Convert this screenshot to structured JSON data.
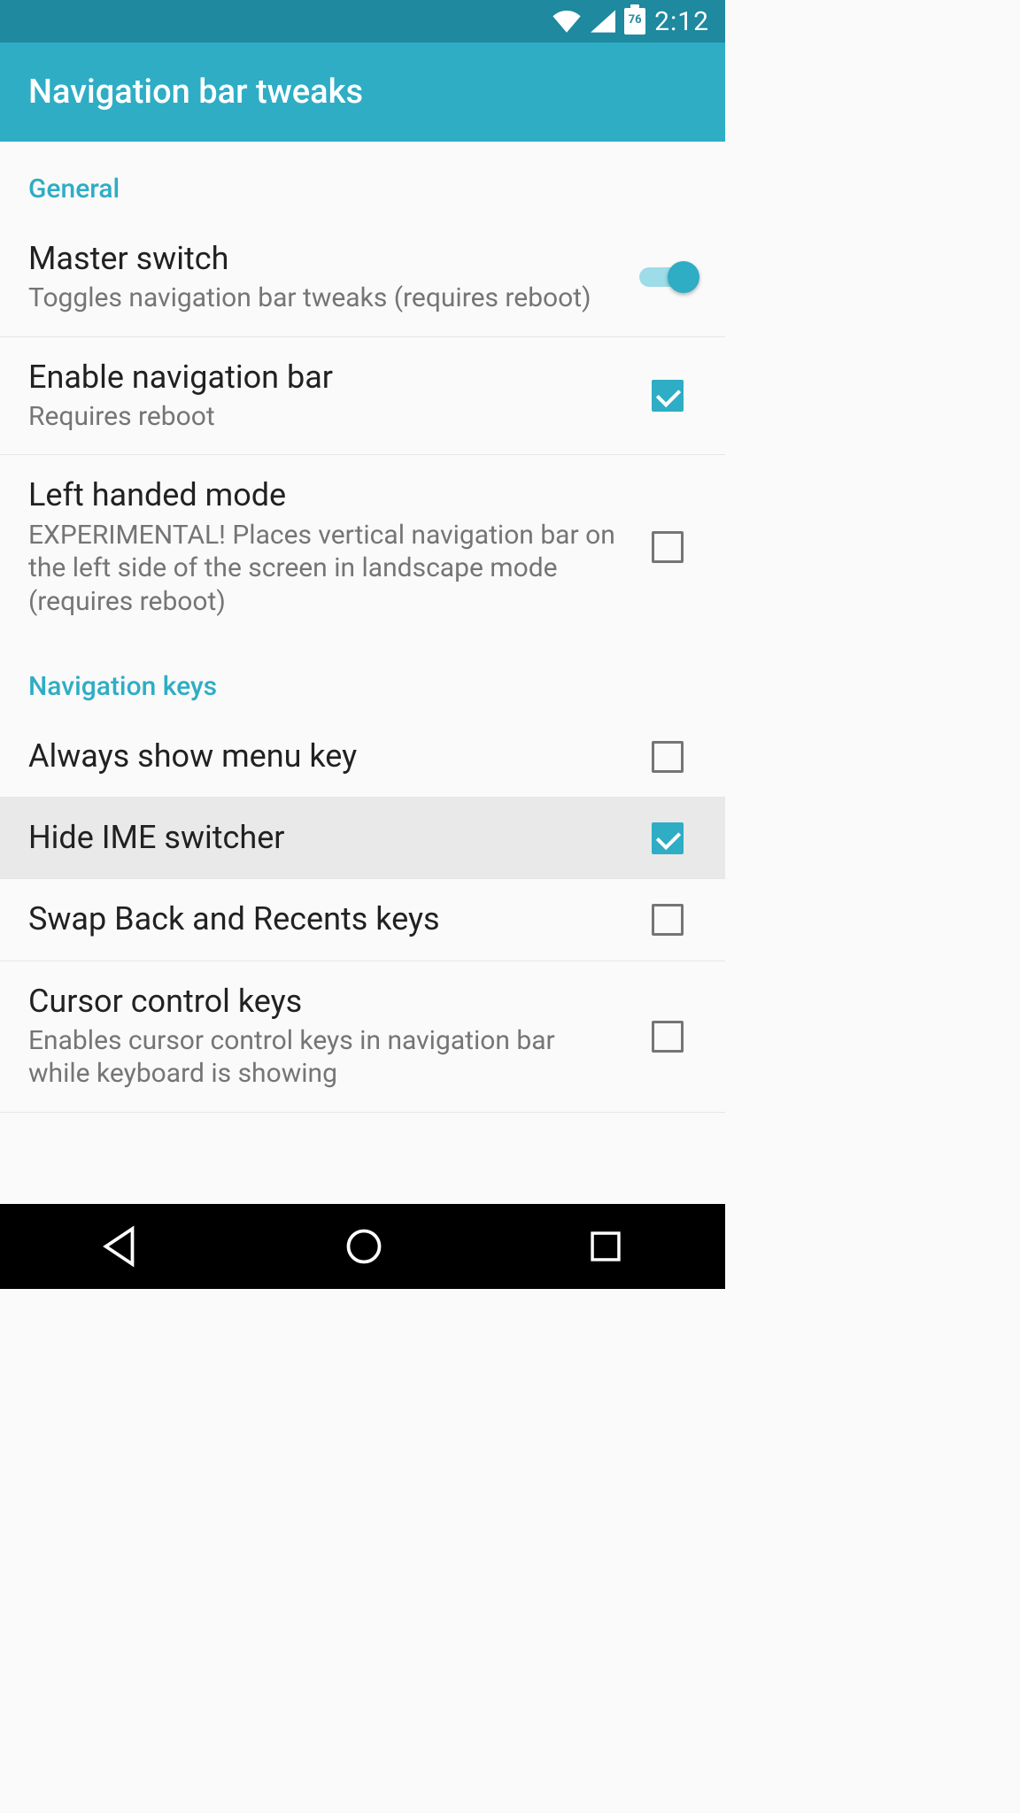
{
  "status": {
    "battery": "76",
    "time": "2:12"
  },
  "app_bar": {
    "title": "Navigation bar tweaks"
  },
  "sections": {
    "general": {
      "header": "General",
      "master_switch": {
        "title": "Master switch",
        "sub": "Toggles navigation bar tweaks (requires reboot)",
        "on": true
      },
      "enable_nav": {
        "title": "Enable navigation bar",
        "sub": "Requires reboot",
        "checked": true
      },
      "left_handed": {
        "title": "Left handed mode",
        "sub": "EXPERIMENTAL! Places vertical navigation bar on the left side of the screen in landscape mode (requires reboot)",
        "checked": false
      }
    },
    "navkeys": {
      "header": "Navigation keys",
      "always_menu": {
        "title": "Always show menu key",
        "checked": false
      },
      "hide_ime": {
        "title": "Hide IME switcher",
        "checked": true
      },
      "swap_back": {
        "title": "Swap Back and Recents keys",
        "checked": false
      },
      "cursor_ctrl": {
        "title": "Cursor control keys",
        "sub": "Enables cursor control keys in navigation bar while keyboard is showing",
        "checked": false
      }
    }
  }
}
